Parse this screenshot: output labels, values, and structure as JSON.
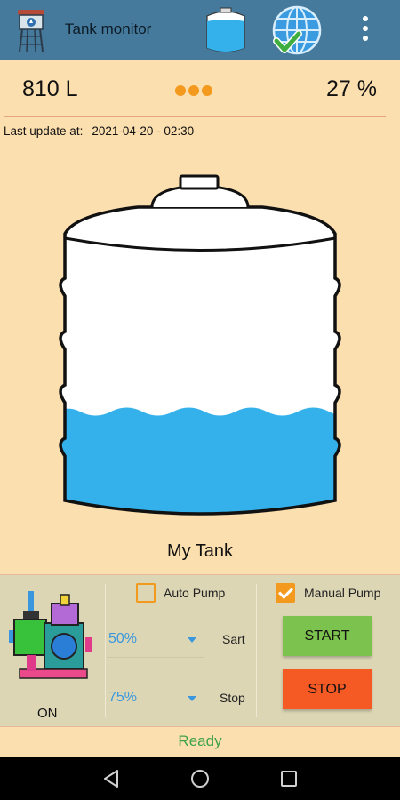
{
  "app": {
    "title": "Tank monitor"
  },
  "stats": {
    "volume": "810 L",
    "percent": "27 %",
    "level_fraction": 0.27
  },
  "update": {
    "label": "Last update at:",
    "value": "2021-04-20 - 02:30"
  },
  "tank": {
    "name": "My Tank"
  },
  "pump": {
    "status": "ON",
    "auto_label": "Auto Pump",
    "auto_checked": false,
    "manual_label": "Manual Pump",
    "manual_checked": true,
    "start_value": "50%",
    "start_label": "Sart",
    "stop_value": "75%",
    "stop_label": "Stop",
    "start_button": "START",
    "stop_button": "STOP"
  },
  "status": {
    "text": "Ready"
  },
  "colors": {
    "appbar": "#457a9c",
    "background": "#fcdfae",
    "accent_orange": "#f39a1e",
    "water": "#34b1ea",
    "start_button": "#7cc24e",
    "stop_button": "#f55a25",
    "status_ready": "#3fa34d",
    "spinner_blue": "#3a97dd"
  },
  "icons": [
    "water-tower-icon",
    "tank-icon",
    "globe-check-icon",
    "more-vert-icon",
    "pump-icon",
    "back-icon",
    "home-icon",
    "recent-apps-icon"
  ]
}
